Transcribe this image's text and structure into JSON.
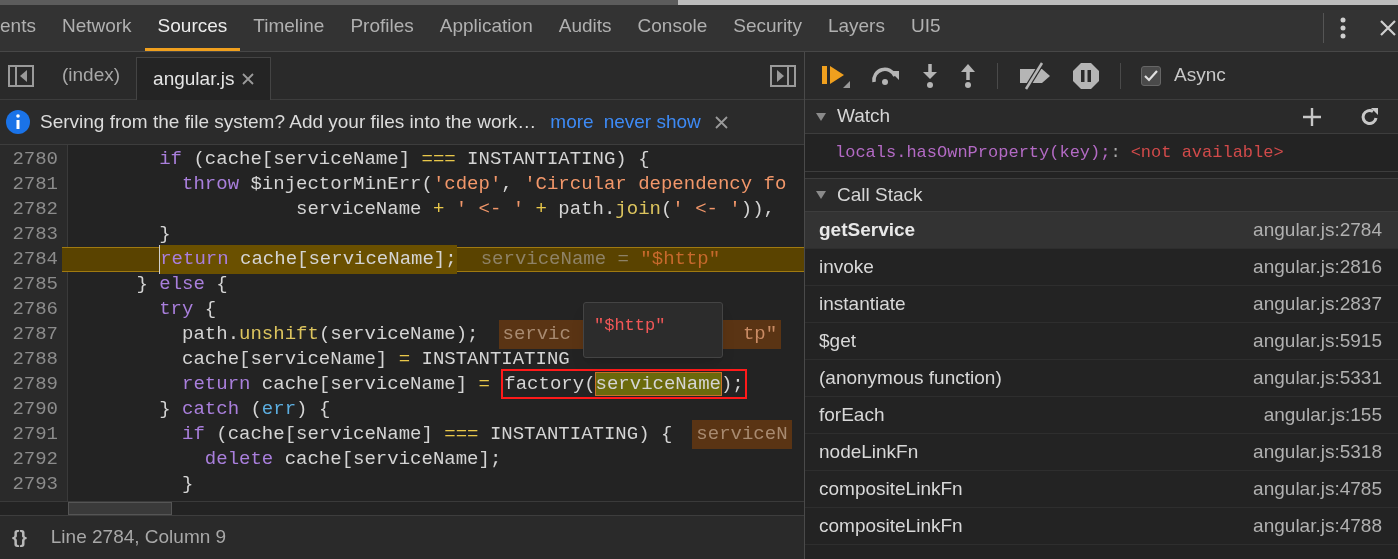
{
  "panel_tabs": [
    {
      "label": "ents",
      "selected": false
    },
    {
      "label": "Network",
      "selected": false
    },
    {
      "label": "Sources",
      "selected": true
    },
    {
      "label": "Timeline",
      "selected": false
    },
    {
      "label": "Profiles",
      "selected": false
    },
    {
      "label": "Application",
      "selected": false
    },
    {
      "label": "Audits",
      "selected": false
    },
    {
      "label": "Console",
      "selected": false
    },
    {
      "label": "Security",
      "selected": false
    },
    {
      "label": "Layers",
      "selected": false
    },
    {
      "label": "UI5",
      "selected": false
    }
  ],
  "file_tabs": [
    {
      "label": "(index)",
      "selected": false,
      "closable": false
    },
    {
      "label": "angular.js",
      "selected": true,
      "closable": true
    }
  ],
  "infobar": {
    "message": "Serving from the file system? Add your files into the work…",
    "links": [
      "more",
      "never show"
    ]
  },
  "code": {
    "lines": [
      {
        "number": "2780",
        "current": false,
        "tokens": [
          {
            "text": "        if",
            "kind": "kw"
          },
          {
            "text": " (cache[serviceName] ",
            "kind": "plain"
          },
          {
            "text": "===",
            "kind": "op"
          },
          {
            "text": " INSTANTIATING) {",
            "kind": "plain"
          }
        ]
      },
      {
        "number": "2781",
        "current": false,
        "tokens": [
          {
            "text": "          throw",
            "kind": "kw"
          },
          {
            "text": " $injectorMinErr(",
            "kind": "plain"
          },
          {
            "text": "'cdep'",
            "kind": "str"
          },
          {
            "text": ", ",
            "kind": "plain"
          },
          {
            "text": "'Circular dependency fo",
            "kind": "str"
          }
        ]
      },
      {
        "number": "2782",
        "current": false,
        "tokens": [
          {
            "text": "                    serviceName ",
            "kind": "plain"
          },
          {
            "text": "+",
            "kind": "op"
          },
          {
            "text": " ' <- ' ",
            "kind": "str"
          },
          {
            "text": "+",
            "kind": "op"
          },
          {
            "text": " path.",
            "kind": "plain"
          },
          {
            "text": "join",
            "kind": "call"
          },
          {
            "text": "(",
            "kind": "plain"
          },
          {
            "text": "' <- '",
            "kind": "str"
          },
          {
            "text": ")),",
            "kind": "plain"
          }
        ]
      },
      {
        "number": "2783",
        "current": false,
        "tokens": [
          {
            "text": "        }",
            "kind": "plain"
          }
        ]
      },
      {
        "number": "2784",
        "current": true,
        "tokens": [
          {
            "text": "        return",
            "kind": "kw"
          },
          {
            "text": " cache[serviceName];",
            "kind": "plain"
          }
        ],
        "annotation": [
          {
            "text": "serviceName = ",
            "kind": "name"
          },
          {
            "text": "\"$http\"",
            "kind": "value"
          }
        ]
      },
      {
        "number": "2785",
        "current": false,
        "tokens": [
          {
            "text": "      } ",
            "kind": "plain"
          },
          {
            "text": "else",
            "kind": "kw"
          },
          {
            "text": " {",
            "kind": "plain"
          }
        ]
      },
      {
        "number": "2786",
        "current": false,
        "tokens": [
          {
            "text": "        try",
            "kind": "kw"
          },
          {
            "text": " {",
            "kind": "plain"
          }
        ]
      },
      {
        "number": "2787",
        "current": false,
        "tokens": [
          {
            "text": "          path.",
            "kind": "plain"
          },
          {
            "text": "unshift",
            "kind": "call"
          },
          {
            "text": "(serviceName);",
            "kind": "plain"
          }
        ],
        "annotation": [
          {
            "text": "servic",
            "kind": "name"
          },
          {
            "text": "tp\"",
            "kind": "value",
            "covered_before": true
          }
        ]
      },
      {
        "number": "2788",
        "current": false,
        "tokens": [
          {
            "text": "          cache[serviceName] ",
            "kind": "plain"
          },
          {
            "text": "=",
            "kind": "op"
          },
          {
            "text": " INSTANTIATING",
            "kind": "plain"
          }
        ]
      },
      {
        "number": "2789",
        "current": false,
        "tokens": [
          {
            "text": "          return",
            "kind": "kw"
          },
          {
            "text": " cache[serviceName] ",
            "kind": "plain"
          },
          {
            "text": "= ",
            "kind": "op"
          },
          {
            "text": "factory(",
            "kind": "plain",
            "boxed": true
          },
          {
            "text": "serviceName",
            "kind": "plain",
            "boxed": true,
            "highlighted": true
          },
          {
            "text": ");",
            "kind": "plain",
            "boxed": true
          }
        ]
      },
      {
        "number": "2790",
        "current": false,
        "tokens": [
          {
            "text": "        } ",
            "kind": "plain"
          },
          {
            "text": "catch",
            "kind": "kw"
          },
          {
            "text": " (",
            "kind": "plain"
          },
          {
            "text": "err",
            "kind": "param"
          },
          {
            "text": ") {",
            "kind": "plain"
          }
        ]
      },
      {
        "number": "2791",
        "current": false,
        "tokens": [
          {
            "text": "          if",
            "kind": "kw"
          },
          {
            "text": " (cache[serviceName] ",
            "kind": "plain"
          },
          {
            "text": "===",
            "kind": "op"
          },
          {
            "text": " INSTANTIATING) {",
            "kind": "plain"
          }
        ],
        "annotation": [
          {
            "text": "serviceN",
            "kind": "name"
          }
        ]
      },
      {
        "number": "2792",
        "current": false,
        "tokens": [
          {
            "text": "            delete",
            "kind": "kw"
          },
          {
            "text": " cache[serviceName];",
            "kind": "plain"
          }
        ]
      },
      {
        "number": "2793",
        "current": false,
        "tokens": [
          {
            "text": "          }",
            "kind": "plain"
          }
        ]
      }
    ],
    "tooltip": "\"$http\""
  },
  "status_bar": {
    "format_button": "{}",
    "position": "Line 2784, Column 9"
  },
  "debugger": {
    "async": {
      "label": "Async",
      "checked": true
    },
    "watch": {
      "title": "Watch",
      "expanded": true,
      "expressions": [
        {
          "expression": "locals.hasOwnProperty(key);",
          "separator": ":",
          "value": "<not available>"
        }
      ]
    },
    "call_stack": {
      "title": "Call Stack",
      "expanded": true,
      "frames": [
        {
          "name": "getService",
          "location": "angular.js:2784",
          "selected": true
        },
        {
          "name": "invoke",
          "location": "angular.js:2816",
          "selected": false
        },
        {
          "name": "instantiate",
          "location": "angular.js:2837",
          "selected": false
        },
        {
          "name": "$get",
          "location": "angular.js:5915",
          "selected": false
        },
        {
          "name": "(anonymous function)",
          "location": "angular.js:5331",
          "selected": false
        },
        {
          "name": "forEach",
          "location": "angular.js:155",
          "selected": false
        },
        {
          "name": "nodeLinkFn",
          "location": "angular.js:5318",
          "selected": false
        },
        {
          "name": "compositeLinkFn",
          "location": "angular.js:4785",
          "selected": false
        },
        {
          "name": "compositeLinkFn",
          "location": "angular.js:4788",
          "selected": false
        }
      ]
    }
  }
}
